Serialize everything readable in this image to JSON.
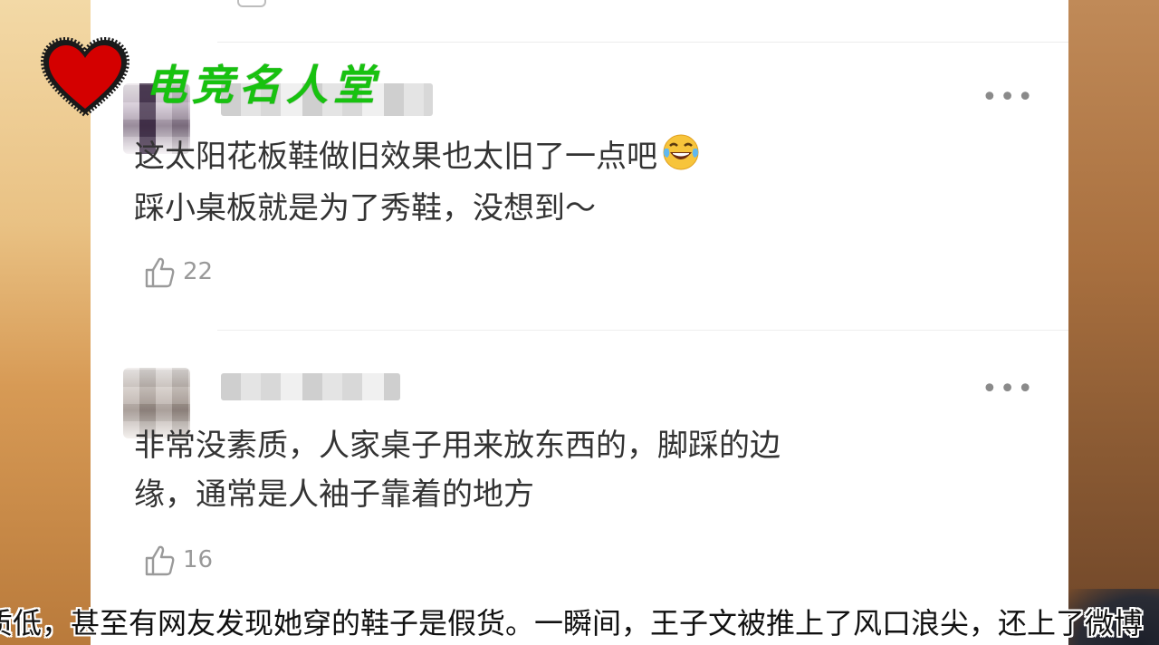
{
  "overlay": {
    "logo_text": "电竞名人堂",
    "subtitle": "质低，甚至有网友发现她穿的鞋子是假货。一瞬间，王子文被推上了风口浪尖，还上了微博"
  },
  "comments": [
    {
      "line1": "这太阳花板鞋做旧效果也太旧了一点吧",
      "emoji": "laughing-tears-emoji",
      "line2": "踩小桌板就是为了秀鞋，没想到～",
      "likes": "22"
    },
    {
      "line1": "非常没素质，人家桌子用来放东西的，脚踩的边",
      "line2": "缘，通常是人袖子靠着的地方",
      "likes": "16"
    }
  ],
  "more_glyph": "•••",
  "colors": {
    "card_bg": "#ffffff",
    "text": "#333333",
    "muted": "#999999",
    "logo_green": "#17c20f",
    "heart_red": "#d40000"
  }
}
